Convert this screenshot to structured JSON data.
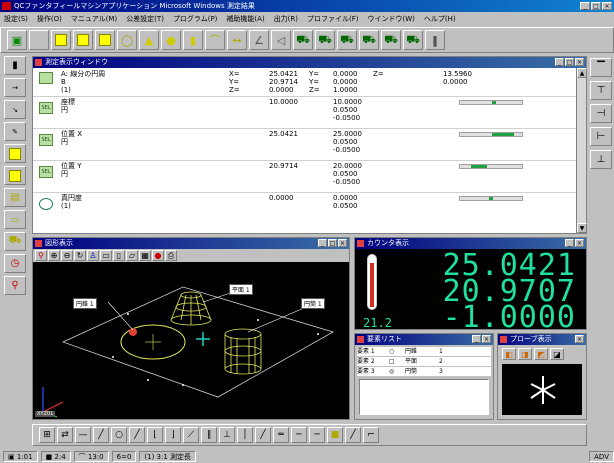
{
  "window": {
    "title": "QCファンタフィールマシンアプリケーション    Microsoft Windows 測定結果"
  },
  "menu": [
    "設定(S)",
    "操作(O)",
    "マニュアル(M)",
    "公差設定(T)",
    "プログラム(P)",
    "補助機能(A)",
    "出力(R)",
    "プロファイル(F)",
    "ウインドウ(W)",
    "ヘルプ(H)"
  ],
  "measurement_panel": {
    "title": "測定表示ウィンドウ",
    "rows": [
      {
        "label": "A: 線分の円周",
        "axis1": "X=",
        "v1": "25.0421",
        "axis2": "Y=",
        "v2": "0.0000",
        "axis3": "Z=",
        "v3": "13.5960"
      },
      {
        "label": "B",
        "axis1": "Y=",
        "v1": "20.9714",
        "axis2": "Y=",
        "v2": "0.0000",
        "axis3": "",
        "v3": "0.0000"
      },
      {
        "label": "(1)",
        "axis1": "Z=",
        "v1": "0.0000",
        "axis2": "Z=",
        "v2": "1.0000",
        "axis3": "",
        "v3": ""
      }
    ],
    "features": [
      {
        "name": "座標",
        "sub": "円",
        "val1": "10.0000",
        "val2": "10.0000",
        "val3": "0.0500",
        "val4": "-0.0500",
        "tol_pos": 0.55
      },
      {
        "name": "位置 X",
        "sub": "円",
        "val1": "25.0421",
        "val2": "25.0000",
        "val3": "0.0500",
        "val4": "-0.0500",
        "tol_pos": 0.7
      },
      {
        "name": "位置 Y",
        "sub": "円",
        "val1": "20.9714",
        "val2": "20.0000",
        "val3": "0.0500",
        "val4": "-0.0500",
        "tol_pos": 0.3
      },
      {
        "name": "真円度",
        "sub": "(1)",
        "val1": "0.0000",
        "val2": "0.0000",
        "val3": "0.0500",
        "val4": "",
        "tol_pos": 0.5
      }
    ],
    "extra_top": {
      "left1": "-0.0000",
      "left2": "0.0000",
      "left3": "-0.0500"
    }
  },
  "graphics_panel": {
    "title": "図形表示",
    "labels": [
      "円錐 1",
      "平面 1",
      "円筒 1"
    ],
    "footer_tag": "XYZ01"
  },
  "dro_panel": {
    "title": "カウンタ表示",
    "x": "25.0421",
    "y": "20.9707",
    "z": "-1.0000",
    "temp": "21.2"
  },
  "list_panel": {
    "title": "要素リスト",
    "items": [
      {
        "name": "要素 1",
        "mark": "○",
        "kind": "円錐",
        "n": "1"
      },
      {
        "name": "要素 2",
        "mark": "□",
        "kind": "平面",
        "n": "2"
      },
      {
        "name": "要素 3",
        "mark": "◎",
        "kind": "円筒",
        "n": "3"
      }
    ]
  },
  "probe_panel": {
    "title": "プローブ表示"
  },
  "statusbar": {
    "cells": [
      "▣ 1:01",
      "■ 2:4",
      "⌒ 13:0",
      "6=0",
      "(1) 3:1 測定長",
      "ADV"
    ]
  },
  "colors": {
    "titlebar": "#000080",
    "dro_text": "#20e0a0",
    "tol_fill": "#20a040",
    "wire": "#e8e860"
  }
}
